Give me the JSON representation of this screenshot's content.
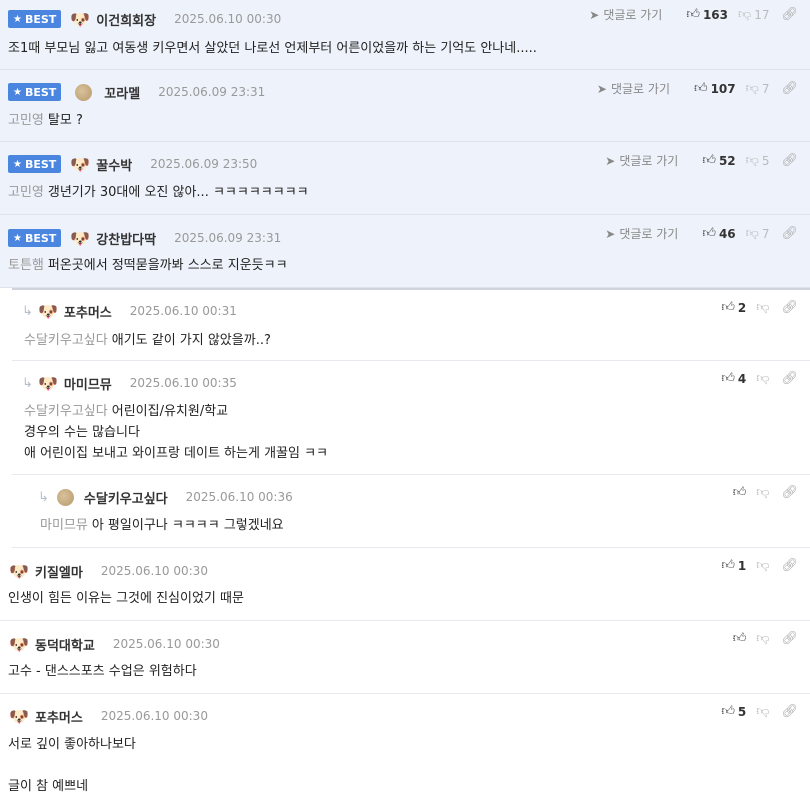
{
  "ui": {
    "best": "BEST",
    "goto_reply": "댓글로 가기"
  },
  "comments": [
    {
      "nick": "이건희회장",
      "date": "2025.06.10 00:30",
      "up": "163",
      "down": "17",
      "text": "조1때 부모님 잃고 여동생 키우면서 살았던 나로선 언제부터 어른이었을까 하는 기억도 안나네....."
    },
    {
      "nick": "꼬라멜",
      "date": "2025.06.09 23:31",
      "up": "107",
      "down": "7",
      "tag": "고민영",
      "text": "탈모 ?"
    },
    {
      "nick": "꿀수박",
      "date": "2025.06.09 23:50",
      "up": "52",
      "down": "5",
      "tag": "고민영",
      "text": "갱년기가 30대에 오진 않아... ㅋㅋㅋㅋㅋㅋㅋㅋ"
    },
    {
      "nick": "강찬밥다딱",
      "date": "2025.06.09 23:31",
      "up": "46",
      "down": "7",
      "tag": "토튼햄",
      "text": "퍼온곳에서 정떡묻을까봐 스스로 지운듯ㅋㅋ"
    },
    {
      "nick": "포추머스",
      "date": "2025.06.10 00:31",
      "up": "2",
      "tag": "수달키우고싶다",
      "text": "애기도 같이 가지 않았을까..?"
    },
    {
      "nick": "마미므뮤",
      "date": "2025.06.10 00:35",
      "up": "4",
      "tag": "수달키우고싶다",
      "text": "어린이집/유치원/학교",
      "line2": "경우의 수는 많습니다",
      "line3": "애 어린이집 보내고 와이프랑 데이트 하는게 개꿀임 ㅋㅋ"
    },
    {
      "nick": "수달키우고싶다",
      "date": "2025.06.10 00:36",
      "tag": "마미므뮤",
      "text": "아 평일이구나 ㅋㅋㅋㅋ 그렇겠네요"
    },
    {
      "nick": "키질엘마",
      "date": "2025.06.10 00:30",
      "up": "1",
      "text": "인생이 힘든 이유는 그것에 진심이었기 때문"
    },
    {
      "nick": "동덕대학교",
      "date": "2025.06.10 00:30",
      "text": "고수 - 댄스스포츠 수업은 위험하다"
    },
    {
      "nick": "포추머스",
      "date": "2025.06.10 00:30",
      "up": "5",
      "text": "서로 깊이 좋아하나보다",
      "line3": "글이 참 예쁘네"
    }
  ]
}
